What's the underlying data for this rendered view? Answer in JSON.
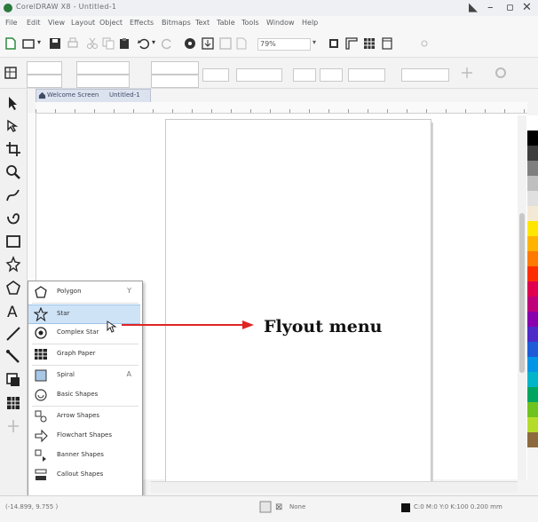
{
  "window": {
    "title": "CorelDRAW X8 - Untitled-1",
    "controls": [
      "◣",
      "–",
      "▫",
      "✕"
    ]
  },
  "menubar": {
    "items": [
      "File",
      "Edit",
      "View",
      "Layout",
      "Object",
      "Effects",
      "Bitmaps",
      "Text",
      "Table",
      "Tools",
      "Window",
      "Help"
    ]
  },
  "toolbar": {
    "zoom_value": "79%"
  },
  "document_tab": {
    "welcome_label": "Welcome Screen",
    "doc_label": "Untitled-1"
  },
  "flyout": {
    "items": [
      {
        "label": "Polygon",
        "icon": "polygon-icon",
        "shortcut": "Y"
      },
      {
        "label": "Star",
        "icon": "star-icon"
      },
      {
        "label": "Complex Star",
        "icon": "complex-star-icon"
      },
      {
        "label": "Graph Paper",
        "icon": "graph-paper-icon"
      },
      {
        "label": "Spiral",
        "icon": "spiral-icon",
        "shortcut": "A"
      },
      {
        "label": "Basic Shapes",
        "icon": "basic-shapes-icon"
      },
      {
        "label": "Arrow Shapes",
        "icon": "arrow-shapes-icon"
      },
      {
        "label": "Flowchart Shapes",
        "icon": "flowchart-shapes-icon"
      },
      {
        "label": "Banner Shapes",
        "icon": "banner-shapes-icon"
      },
      {
        "label": "Callout Shapes",
        "icon": "callout-shapes-icon"
      }
    ]
  },
  "annotation": {
    "text": "Flyout menu"
  },
  "statusbar": {
    "left": "(-14.899, 9.755 )",
    "fill_label": "None",
    "outline_label": "C:0 M:0 Y:0 K:100 0.200 mm"
  },
  "colors": {
    "accent": "#e02424",
    "palette": [
      "#ffffff",
      "#000000",
      "#3d3d3d",
      "#7f7f7f",
      "#bfbfbf",
      "#e0e0e0",
      "#f4e9d5",
      "#ffe600",
      "#ffb300",
      "#ff7a00",
      "#ff2e00",
      "#e0004f",
      "#c0007a",
      "#8a00b0",
      "#4c2bc9",
      "#1e5bd8",
      "#0095e6",
      "#00b5c9",
      "#00a660",
      "#6fc31f",
      "#b6dc2b",
      "#8c6a3e"
    ]
  }
}
